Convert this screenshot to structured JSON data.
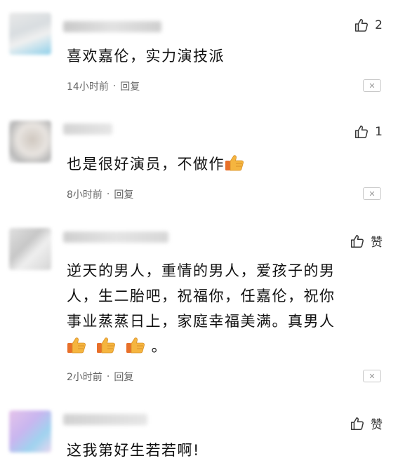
{
  "comments": [
    {
      "text": "喜欢嘉伦，实力演技派",
      "time": "14小时前",
      "reply": "回复",
      "likes": "2"
    },
    {
      "text": "也是很好演员，不做作",
      "time": "8小时前",
      "reply": "回复",
      "likes": "1"
    },
    {
      "text_lines": [
        "逆天的男人，重情的男人，爱孩子的男",
        "人，生二胎吧，祝福你，任嘉伦，祝你",
        "事业蒸蒸日上，家庭幸福美满。真男人"
      ],
      "tail": "。",
      "time": "2小时前",
      "reply": "回复",
      "likes": "赞"
    },
    {
      "text_partial": "这我第好生若若啊!",
      "likes": "赞"
    }
  ],
  "icons": {
    "like": "thumbs-up-outline-icon",
    "emoji": "thumbs-up-emoji",
    "close": "close-icon"
  },
  "colors": {
    "emoji": "#f5b53f",
    "sleeve": "#e8702a"
  }
}
